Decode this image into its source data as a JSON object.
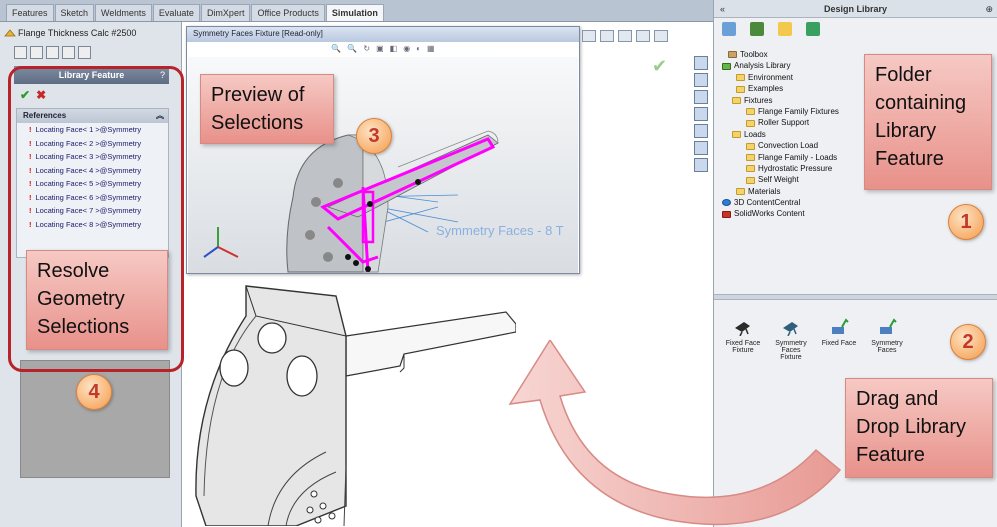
{
  "tabs": [
    "Features",
    "Sketch",
    "Weldments",
    "Evaluate",
    "DimXpert",
    "Office Products",
    "Simulation"
  ],
  "active_tab": "Simulation",
  "left_panel": {
    "title": "Flange Thickness Calc #2500",
    "feature_header": "Library Feature",
    "help": "?",
    "ok": "✔",
    "cancel": "✖",
    "references_label": "References",
    "references": [
      "Locating Face< 1 >@Symmetry",
      "Locating Face< 2 >@Symmetry",
      "Locating Face< 3 >@Symmetry",
      "Locating Face< 4 >@Symmetry",
      "Locating Face< 5 >@Symmetry",
      "Locating Face< 6 >@Symmetry",
      "Locating Face< 7 >@Symmetry",
      "Locating Face< 8 >@Symmetry"
    ]
  },
  "preview": {
    "title": "Symmetry Faces Fixture [Read-only]",
    "model_label": "Symmetry Faces - 8 T"
  },
  "design_library": {
    "title": "Design Library",
    "collapse": "«",
    "tree": [
      {
        "label": "Toolbox",
        "icon": "toolbox-icon",
        "indent": 1
      },
      {
        "label": "Analysis Library",
        "icon": "analysis-library-icon",
        "indent": 1
      },
      {
        "label": "Environment",
        "icon": "folder-icon",
        "indent": 2
      },
      {
        "label": "Examples",
        "icon": "folder-icon",
        "indent": 2
      },
      {
        "label": "Fixtures",
        "icon": "folder-icon",
        "indent": 2
      },
      {
        "label": "Flange Family Fixtures",
        "icon": "folder-icon",
        "indent": 3
      },
      {
        "label": "Roller Support",
        "icon": "folder-icon",
        "indent": 3
      },
      {
        "label": "Loads",
        "icon": "folder-icon",
        "indent": 2
      },
      {
        "label": "Convection Load",
        "icon": "folder-icon",
        "indent": 3
      },
      {
        "label": "Flange Family - Loads",
        "icon": "folder-icon",
        "indent": 3
      },
      {
        "label": "Hydrostatic Pressure",
        "icon": "folder-icon",
        "indent": 3
      },
      {
        "label": "Self Weight",
        "icon": "folder-icon",
        "indent": 3
      },
      {
        "label": "Materials",
        "icon": "folder-icon",
        "indent": 2
      },
      {
        "label": "3D ContentCentral",
        "icon": "globe-icon",
        "indent": 1
      },
      {
        "label": "SolidWorks Content",
        "icon": "solidworks-content-icon",
        "indent": 1
      }
    ],
    "features": [
      {
        "label": "Fixed Face Fixture"
      },
      {
        "label": "Symmetry Faces Fixture"
      },
      {
        "label": "Fixed Face"
      },
      {
        "label": "Symmetry Faces"
      }
    ]
  },
  "callouts": {
    "folder": "Folder containing Library Feature",
    "preview": "Preview of Selections",
    "resolve": "Resolve Geometry Selections",
    "drag": "Drag and Drop Library Feature"
  },
  "numbers": {
    "n1": "1",
    "n2": "2",
    "n3": "3",
    "n4": "4"
  },
  "colors": {
    "callout_bg": "#efaaa4",
    "number_circle": "#f59a4a",
    "highlight": "#ff00ff",
    "frame_red": "#b8232a"
  }
}
